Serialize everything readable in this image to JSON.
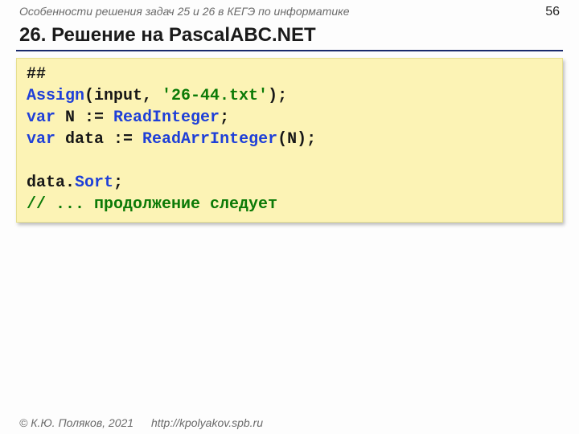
{
  "header": {
    "subject": "Особенности решения задач 25 и 26 в КЕГЭ по информатике",
    "page_number": "56"
  },
  "title": "26. Решение на PascalABC.NET",
  "code": {
    "l1": {
      "a": "##"
    },
    "l2": {
      "a": "Assign",
      "b": "(input, ",
      "c": "'26-44.txt'",
      "d": ");"
    },
    "l3": {
      "a": "var",
      "b": " N := ",
      "c": "ReadInteger",
      "d": ";"
    },
    "l4": {
      "a": "var",
      "b": " data := ",
      "c": "ReadArrInteger",
      "d": "(N);"
    },
    "l5": {
      "a": ""
    },
    "l6": {
      "a": "data.",
      "b": "Sort",
      "c": ";"
    },
    "l7": {
      "a": "// ... продолжение следует"
    }
  },
  "footer": {
    "copyright": "© К.Ю. Поляков, 2021",
    "url": "http://kpolyakov.spb.ru"
  }
}
